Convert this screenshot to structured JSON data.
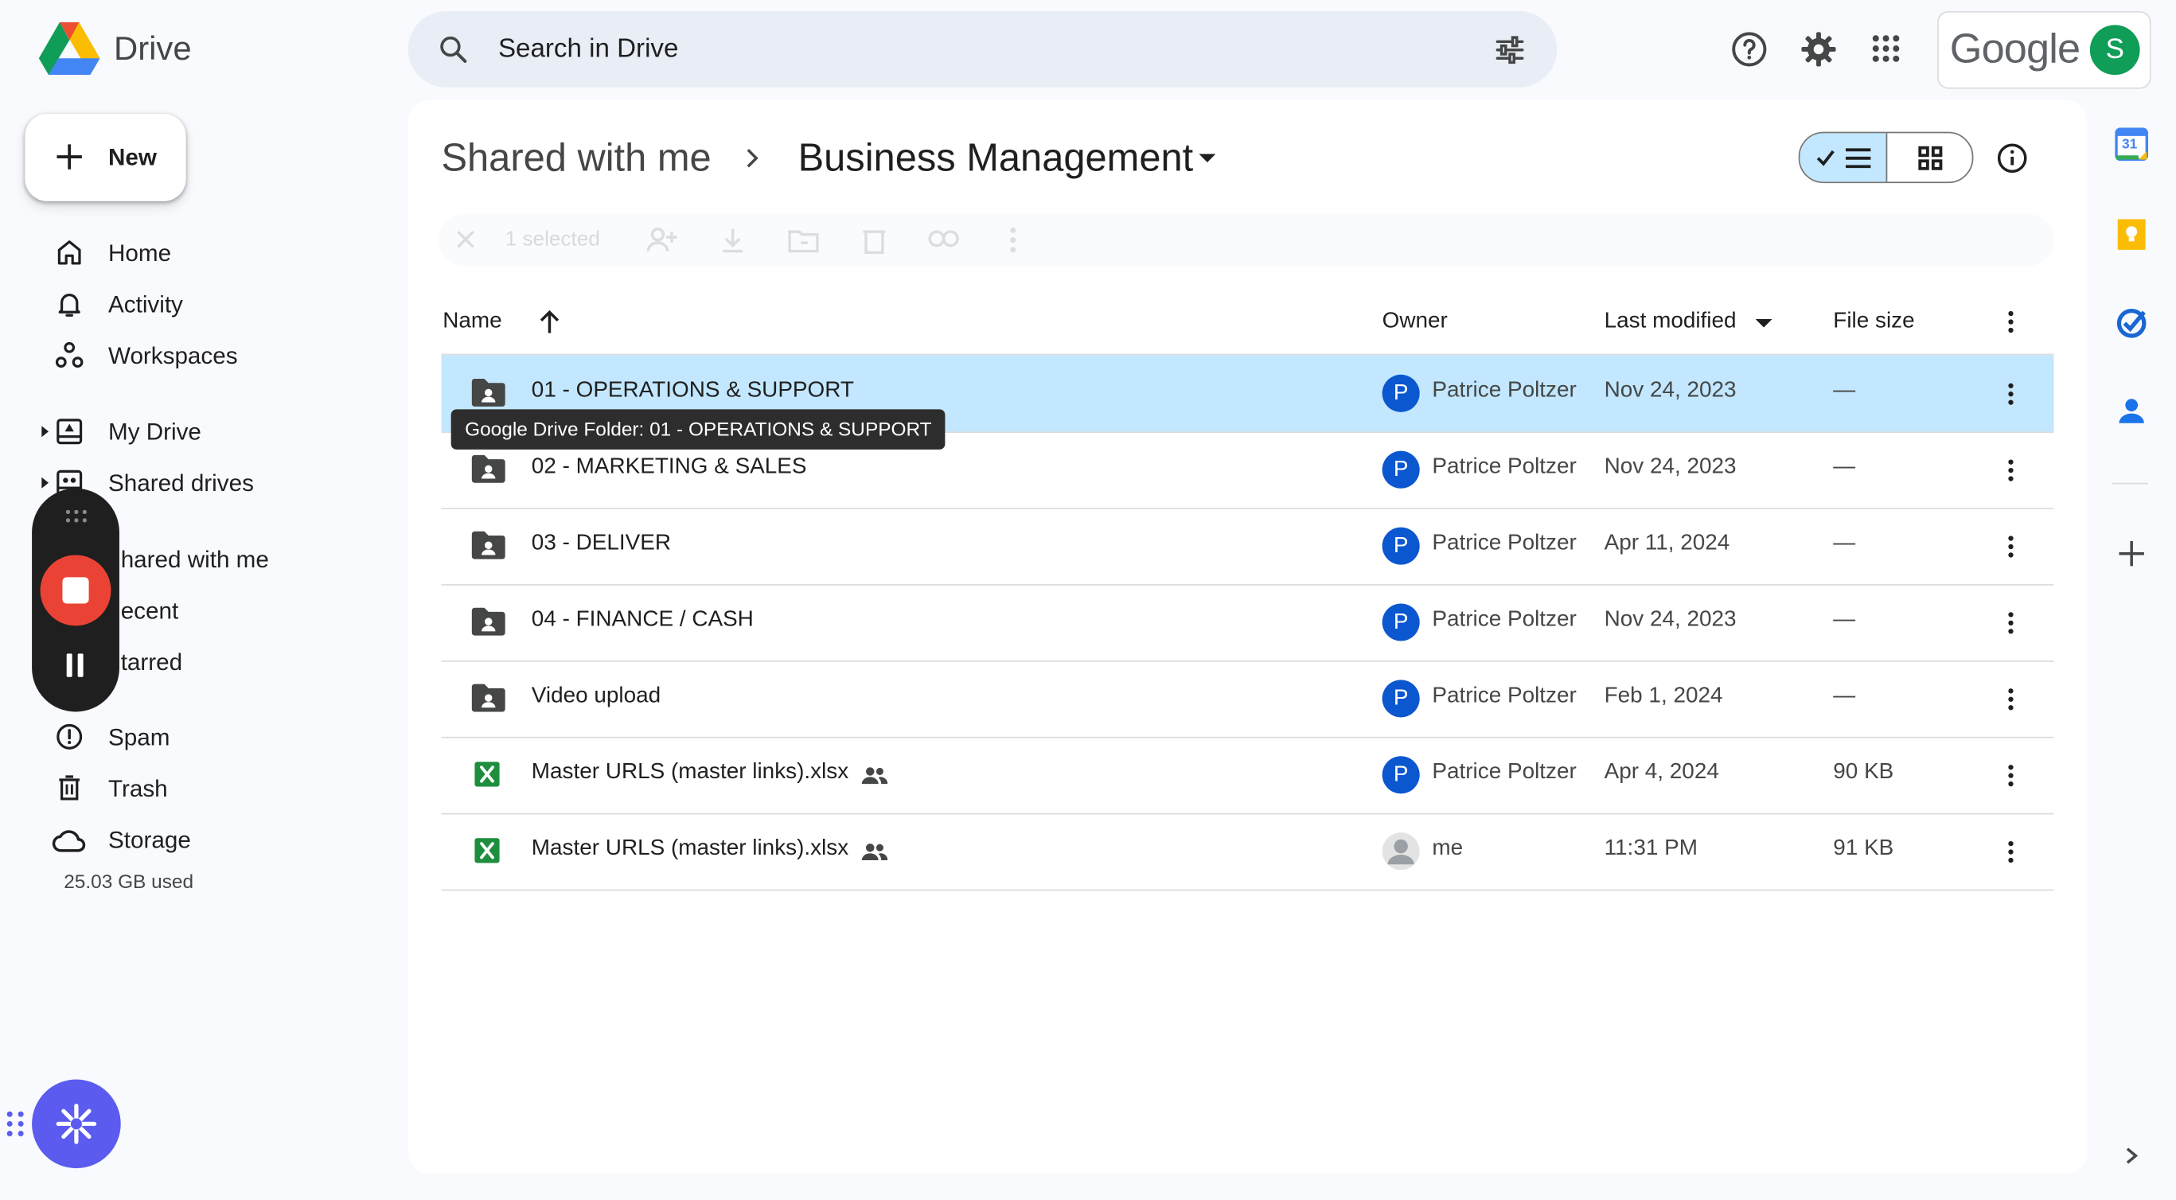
{
  "app": {
    "name": "Drive",
    "search_placeholder": "Search in Drive",
    "google_word": "Google",
    "avatar_initial": "S"
  },
  "sidebar": {
    "new_label": "New",
    "items": [
      {
        "label": "Home",
        "icon": "home-icon"
      },
      {
        "label": "Activity",
        "icon": "bell-icon"
      },
      {
        "label": "Workspaces",
        "icon": "workspaces-icon"
      },
      {
        "label": "My Drive",
        "icon": "my-drive-icon"
      },
      {
        "label": "Shared drives",
        "icon": "shared-drives-icon"
      },
      {
        "label": "Shared with me",
        "visible_text": "hared with me",
        "icon": "people-icon"
      },
      {
        "label": "Recent",
        "visible_text": "ecent",
        "icon": "clock-icon"
      },
      {
        "label": "Starred",
        "visible_text": "tarred",
        "icon": "star-icon"
      },
      {
        "label": "Spam",
        "icon": "spam-icon"
      },
      {
        "label": "Trash",
        "icon": "trash-icon"
      },
      {
        "label": "Storage",
        "icon": "cloud-icon"
      }
    ],
    "storage_used": "25.03 GB used"
  },
  "main": {
    "breadcrumb": {
      "parent": "Shared with me",
      "current": "Business Management"
    },
    "actionbar": {
      "selected_text": "1 selected"
    },
    "columns": {
      "name": "Name",
      "owner": "Owner",
      "modified": "Last modified",
      "size": "File size"
    },
    "rows": [
      {
        "name": "01 - OPERATIONS & SUPPORT",
        "type": "shared-folder",
        "owner": "Patrice Poltzer",
        "owner_initial": "P",
        "modified": "Nov 24, 2023",
        "size": "—",
        "selected": true
      },
      {
        "name": "02 - MARKETING & SALES",
        "type": "shared-folder",
        "owner": "Patrice Poltzer",
        "owner_initial": "P",
        "modified": "Nov 24, 2023",
        "size": "—"
      },
      {
        "name": "03 - DELIVER",
        "type": "shared-folder",
        "owner": "Patrice Poltzer",
        "owner_initial": "P",
        "modified": "Apr 11, 2024",
        "size": "—"
      },
      {
        "name": "04 - FINANCE / CASH",
        "type": "shared-folder",
        "owner": "Patrice Poltzer",
        "owner_initial": "P",
        "modified": "Nov 24, 2023",
        "size": "—"
      },
      {
        "name": "Video upload",
        "type": "shared-folder",
        "owner": "Patrice Poltzer",
        "owner_initial": "P",
        "modified": "Feb 1, 2024",
        "size": "—"
      },
      {
        "name": "Master URLS (master links).xlsx",
        "type": "excel",
        "shared": true,
        "owner": "Patrice Poltzer",
        "owner_initial": "P",
        "modified": "Apr 4, 2024",
        "size": "90 KB"
      },
      {
        "name": "Master URLS (master links).xlsx",
        "type": "excel",
        "shared": true,
        "owner": "me",
        "owner_initial": "",
        "modified": "11:31 PM",
        "size": "91 KB"
      }
    ],
    "tooltip": "Google Drive Folder: 01 - OPERATIONS & SUPPORT"
  },
  "right_rail": {
    "calendar_day": "31"
  },
  "colors": {
    "selected_row": "#c2e7ff",
    "accent_blue": "#0b57d0",
    "record_red": "#ea4335",
    "assistant_purple": "#5b5bf0",
    "excel_green": "#1e8e3e"
  }
}
